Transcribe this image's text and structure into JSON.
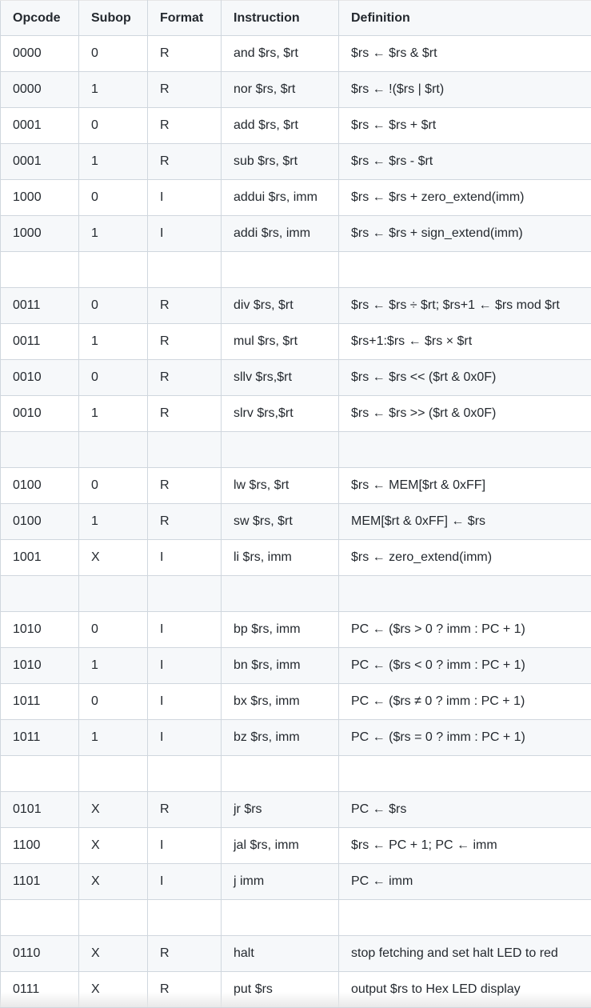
{
  "table": {
    "headers": [
      "Opcode",
      "Subop",
      "Format",
      "Instruction",
      "Definition"
    ],
    "rows": [
      [
        "0000",
        "0",
        "R",
        "and $rs, $rt",
        "$rs ← $rs & $rt"
      ],
      [
        "0000",
        "1",
        "R",
        "nor $rs, $rt",
        "$rs ← !($rs | $rt)"
      ],
      [
        "0001",
        "0",
        "R",
        "add $rs, $rt",
        "$rs ← $rs + $rt"
      ],
      [
        "0001",
        "1",
        "R",
        "sub $rs, $rt",
        "$rs ← $rs - $rt"
      ],
      [
        "1000",
        "0",
        "I",
        "addui $rs, imm",
        "$rs ← $rs + zero_extend(imm)"
      ],
      [
        "1000",
        "1",
        "I",
        "addi $rs, imm",
        "$rs ← $rs + sign_extend(imm)"
      ],
      [
        "",
        "",
        "",
        "",
        ""
      ],
      [
        "0011",
        "0",
        "R",
        "div $rs, $rt",
        "$rs ← $rs ÷ $rt; $rs+1 ← $rs mod $rt"
      ],
      [
        "0011",
        "1",
        "R",
        "mul $rs, $rt",
        "$rs+1:$rs ← $rs × $rt"
      ],
      [
        "0010",
        "0",
        "R",
        "sllv $rs,$rt",
        "$rs ← $rs << ($rt & 0x0F)"
      ],
      [
        "0010",
        "1",
        "R",
        "slrv $rs,$rt",
        "$rs ← $rs >> ($rt & 0x0F)"
      ],
      [
        "",
        "",
        "",
        "",
        ""
      ],
      [
        "0100",
        "0",
        "R",
        "lw $rs, $rt",
        "$rs ← MEM[$rt & 0xFF]"
      ],
      [
        "0100",
        "1",
        "R",
        "sw $rs, $rt",
        "MEM[$rt & 0xFF] ← $rs"
      ],
      [
        "1001",
        "X",
        "I",
        "li $rs, imm",
        "$rs ← zero_extend(imm)"
      ],
      [
        "",
        "",
        "",
        "",
        ""
      ],
      [
        "1010",
        "0",
        "I",
        "bp $rs, imm",
        "PC ← ($rs > 0 ? imm : PC + 1)"
      ],
      [
        "1010",
        "1",
        "I",
        "bn $rs, imm",
        "PC ← ($rs < 0 ? imm : PC + 1)"
      ],
      [
        "1011",
        "0",
        "I",
        "bx $rs, imm",
        "PC ← ($rs ≠ 0 ? imm : PC + 1)"
      ],
      [
        "1011",
        "1",
        "I",
        "bz $rs, imm",
        "PC ← ($rs = 0 ? imm : PC + 1)"
      ],
      [
        "",
        "",
        "",
        "",
        ""
      ],
      [
        "0101",
        "X",
        "R",
        "jr $rs",
        "PC ← $rs"
      ],
      [
        "1100",
        "X",
        "I",
        "jal $rs, imm",
        "$rs ← PC + 1; PC ← imm"
      ],
      [
        "1101",
        "X",
        "I",
        "j imm",
        "PC ← imm"
      ],
      [
        "",
        "",
        "",
        "",
        ""
      ],
      [
        "0110",
        "X",
        "R",
        "halt",
        "stop fetching and set halt LED to red"
      ],
      [
        "0111",
        "X",
        "R",
        "put $rs",
        "output $rs to Hex LED display"
      ]
    ]
  }
}
